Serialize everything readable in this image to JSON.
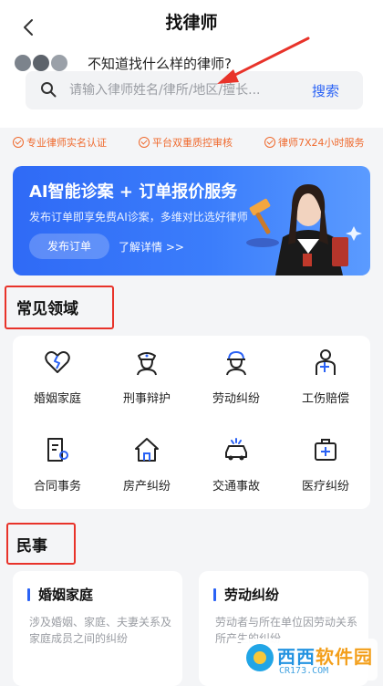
{
  "header": {
    "title": "找律师",
    "back_icon": "chevron-left-icon"
  },
  "prompt": {
    "hint": "不知道找什么样的律师?"
  },
  "search": {
    "placeholder": "请输入律师姓名/律所/地区/擅长...",
    "button": "搜索"
  },
  "trust": [
    {
      "label": "专业律师实名认证"
    },
    {
      "label": "平台双重质控审核"
    },
    {
      "label": "律师7X24小时服务"
    }
  ],
  "banner": {
    "title": "AI智能诊案 + 订单报价服务",
    "subtitle": "发布订单即享免费AI诊案，多维对比选好律师",
    "button": "发布订单",
    "more": "了解详情 >>"
  },
  "common": {
    "title": "常见领域",
    "items": [
      {
        "label": "婚姻家庭",
        "icon": "broken-heart-icon"
      },
      {
        "label": "刑事辩护",
        "icon": "police-officer-icon"
      },
      {
        "label": "劳动纠纷",
        "icon": "worker-icon"
      },
      {
        "label": "工伤赔偿",
        "icon": "injured-person-icon"
      },
      {
        "label": "合同事务",
        "icon": "contract-icon"
      },
      {
        "label": "房产纠纷",
        "icon": "house-icon"
      },
      {
        "label": "交通事故",
        "icon": "car-crash-icon"
      },
      {
        "label": "医疗纠纷",
        "icon": "medical-kit-icon"
      }
    ]
  },
  "civil": {
    "title": "民事",
    "cards": [
      {
        "title": "婚姻家庭",
        "desc": "涉及婚姻、家庭、夫妻关系及家庭成员之间的纠纷"
      },
      {
        "title": "劳动纠纷",
        "desc": "劳动者与所在单位因劳动关系所产生的纠纷"
      }
    ]
  },
  "watermark": {
    "brand_a": "西西",
    "brand_b": "软件园",
    "domain": "CR173.COM"
  },
  "colors": {
    "accent": "#2a62f5",
    "trust": "#ef6a2e",
    "highlight": "#e8332a"
  }
}
